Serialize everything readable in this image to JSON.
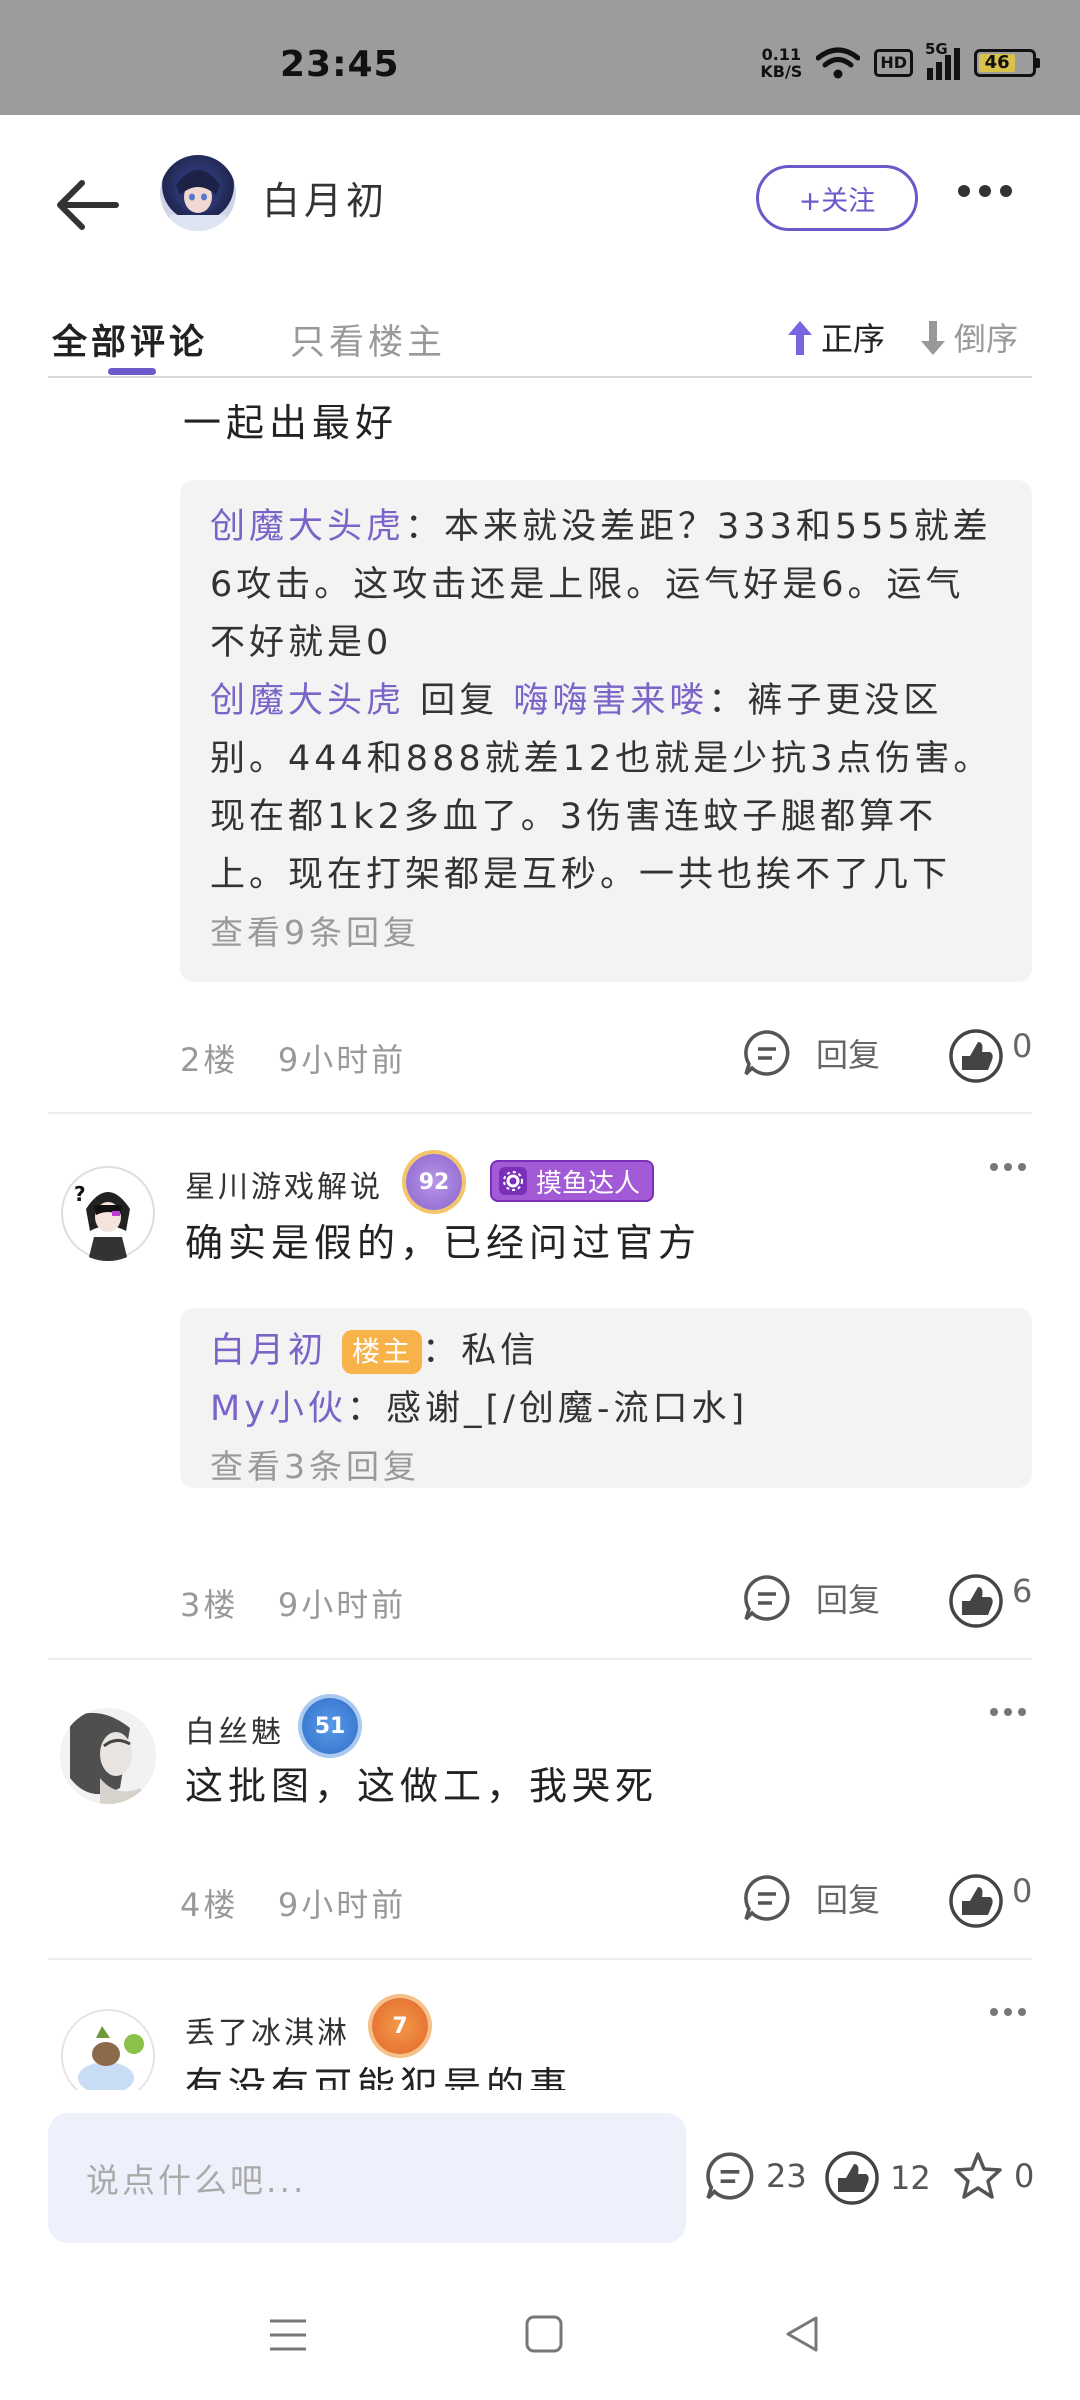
{
  "status": {
    "time": "23:45",
    "net_speed": "0.11",
    "net_unit": "KB/S",
    "hd": "HD",
    "signal": "5G",
    "battery": "46"
  },
  "header": {
    "username": "白月初",
    "follow_label": "+关注"
  },
  "tabs": {
    "all": "全部评论",
    "owner_only": "只看楼主"
  },
  "sort": {
    "asc": "正序",
    "desc": "倒序"
  },
  "colors": {
    "accent": "#6b58c9",
    "reply_name": "#7a64c8",
    "owner_tag": "#f7b24a",
    "badge": "#a35ad6"
  },
  "comments": [
    {
      "text_tail": "一起出最好",
      "replies": {
        "line1_name": "创魔大头虎",
        "line1_sep": "：",
        "line1_text_a": "本来就没差距？333和555就差",
        "line1_text_b": "6攻击。这攻击还是上限。运气好是6。运气",
        "line1_text_c": "不好就是0",
        "line2_name": "创魔大头虎",
        "line2_reply": "回复",
        "line2_target": "嗨嗨害来喽",
        "line2_sep": "：",
        "line2_text_a": "裤子更没区",
        "line2_text_b": "别。444和888就差12也就是少抗3点伤害。",
        "line2_text_c": "现在都1k2多血了。3伤害连蚊子腿都算不",
        "line2_text_d": "上。现在打架都是互秒。一共也挨不了几下",
        "more": "查看9条回复"
      },
      "floor": "2楼",
      "time": "9小时前",
      "reply_label": "回复",
      "likes": "0"
    },
    {
      "user": "星川游戏解说",
      "level": "92",
      "badge": "摸鱼达人",
      "text": "确实是假的，已经问过官方",
      "replies": {
        "line1_name": "白月初",
        "line1_tag": "楼主",
        "line1_sep": "：",
        "line1_text": "私信",
        "line2_name": "My小伙",
        "line2_sep": "：",
        "line2_text": "感谢_[/创魔-流口水]",
        "more": "查看3条回复"
      },
      "floor": "3楼",
      "time": "9小时前",
      "reply_label": "回复",
      "likes": "6"
    },
    {
      "user": "白丝魅",
      "level": "51",
      "text": "这批图，这做工，我哭死",
      "floor": "4楼",
      "time": "9小时前",
      "reply_label": "回复",
      "likes": "0"
    },
    {
      "user": "丢了冰淇淋",
      "level": "7",
      "text": "有没有可能犯是的事"
    }
  ],
  "bottom": {
    "placeholder": "说点什么吧...",
    "comments": "23",
    "likes": "12",
    "stars": "0"
  }
}
